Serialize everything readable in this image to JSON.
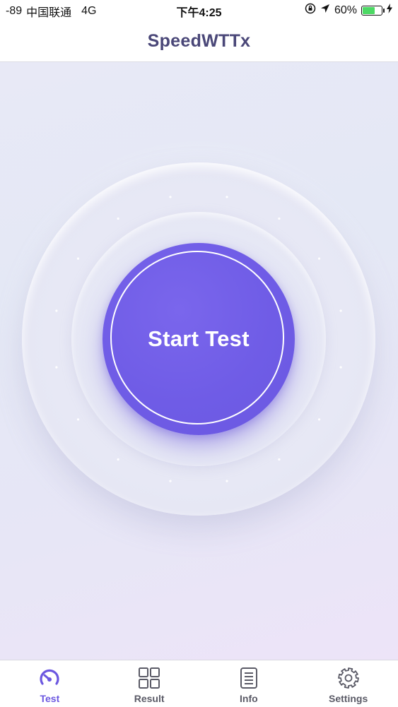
{
  "status_bar": {
    "signal": "-89",
    "carrier": "中国联通",
    "network": "4G",
    "time": "下午4:25",
    "battery_percent": "60%",
    "battery_level": 0.6
  },
  "nav": {
    "title": "SpeedWTTx"
  },
  "main": {
    "start_button_label": "Start Test"
  },
  "tabs": [
    {
      "label": "Test",
      "icon": "speedometer-icon",
      "active": true
    },
    {
      "label": "Result",
      "icon": "grid-icon",
      "active": false
    },
    {
      "label": "Info",
      "icon": "document-icon",
      "active": false
    },
    {
      "label": "Settings",
      "icon": "gear-icon",
      "active": false
    }
  ],
  "colors": {
    "accent": "#6b57e0",
    "button": "#6f5ce6",
    "title": "#4a4778",
    "battery": "#4cd964"
  }
}
